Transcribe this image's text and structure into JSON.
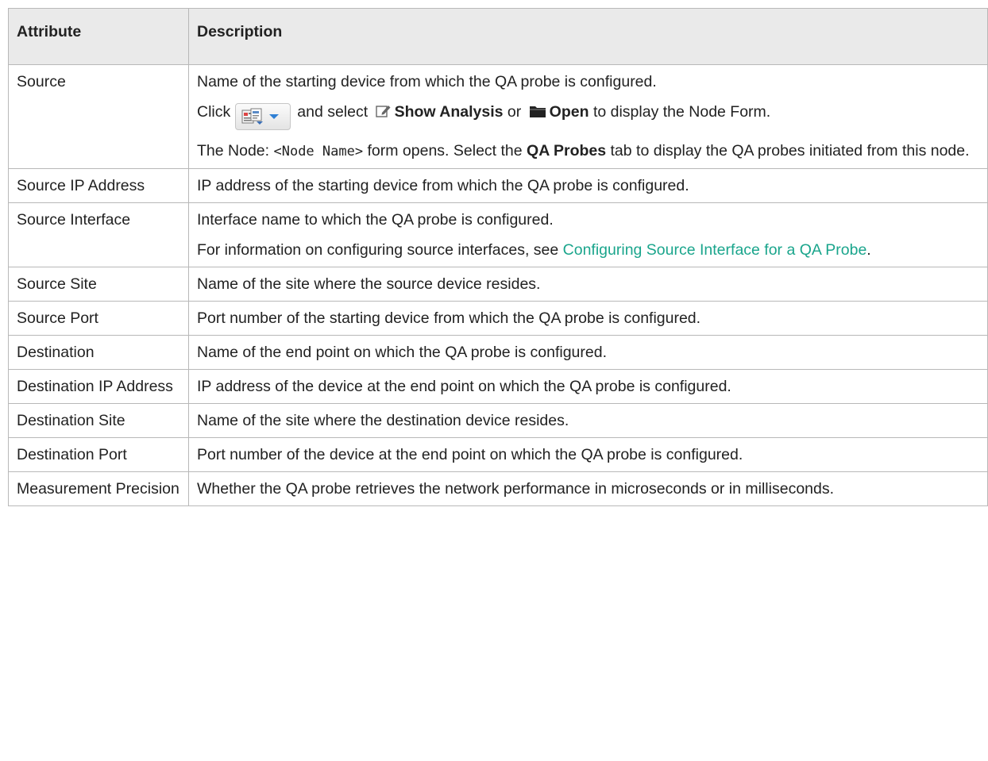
{
  "table": {
    "headers": [
      "Attribute",
      "Description"
    ],
    "rows": [
      {
        "attribute": "Source",
        "desc1": "Name of the starting device from which the QA probe is configured.",
        "click": "Click",
        "and_select": "and select",
        "show_analysis": "Show Analysis",
        "or": "or",
        "open": "Open",
        "to_display": "to display the Node Form.",
        "node_prefix": "The Node:",
        "node_name_code": "<Node Name>",
        "form_opens": "form opens. Select the",
        "qa_probes": "QA Probes",
        "tab_to_display": "tab to display the QA probes initiated from this node."
      },
      {
        "attribute": "Source IP Address",
        "desc": "IP address of the starting device from which the QA probe is configured."
      },
      {
        "attribute": "Source Interface",
        "desc": "Interface name to which the QA probe is configured.",
        "info_prefix": "For information on configuring source interfaces, see",
        "link": "Configuring Source Interface for a QA Probe",
        "info_suffix": "."
      },
      {
        "attribute": "Source Site",
        "desc": "Name of the site where the source device resides."
      },
      {
        "attribute": "Source Port",
        "desc": "Port number of the starting device from which the QA probe is configured."
      },
      {
        "attribute": "Destination",
        "desc": "Name of the end point on which the QA probe is configured."
      },
      {
        "attribute": "Destination IP Address",
        "desc": "IP address of the device at the end point on which the QA probe is configured."
      },
      {
        "attribute": "Destination Site",
        "desc": "Name of the site where the destination device resides."
      },
      {
        "attribute": "Destination Port",
        "desc": "Port number of the device at the end point on which the QA probe is configured."
      },
      {
        "attribute": "Measurement Precision",
        "desc": "Whether the QA probe retrieves the network performance in microseconds or in milliseconds."
      }
    ]
  },
  "icons": {
    "actions_button": "actions-dropdown-icon",
    "show_analysis": "edit-icon",
    "open": "folder-icon"
  },
  "colors": {
    "link": "#1aa58c",
    "header_bg": "#eaeaea",
    "border": "#b8b8b8"
  }
}
